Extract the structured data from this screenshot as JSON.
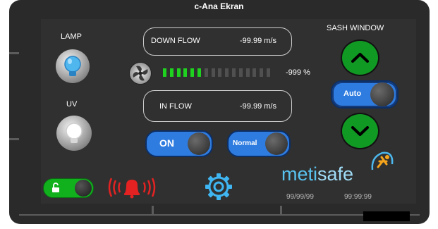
{
  "window": {
    "title": "c-Ana Ekran"
  },
  "lamp": {
    "label": "LAMP"
  },
  "uv": {
    "label": "UV"
  },
  "down_flow": {
    "label": "DOWN FLOW",
    "value": "-99.99 m/s"
  },
  "in_flow": {
    "label": "IN FLOW",
    "value": "-99.99 m/s"
  },
  "fan": {
    "percent_text": "-999 %",
    "level_fraction": 0.375,
    "segments_total": 16
  },
  "sash_window": {
    "label": "SASH WINDOW",
    "mode_label": "Auto"
  },
  "power_toggle": {
    "label": "ON"
  },
  "mode_toggle": {
    "label": "Normal"
  },
  "brand": {
    "part1": "meti",
    "part2": "safe"
  },
  "footer": {
    "date": "99/99/99",
    "time": "99:99:99"
  },
  "colors": {
    "green": "#1fd21f",
    "blue": "#2f7ce0",
    "cyan": "#59c3f0",
    "alarm_red": "#e42222",
    "gear": "#3fb6f2",
    "brand_orange": "#f5a41c"
  }
}
